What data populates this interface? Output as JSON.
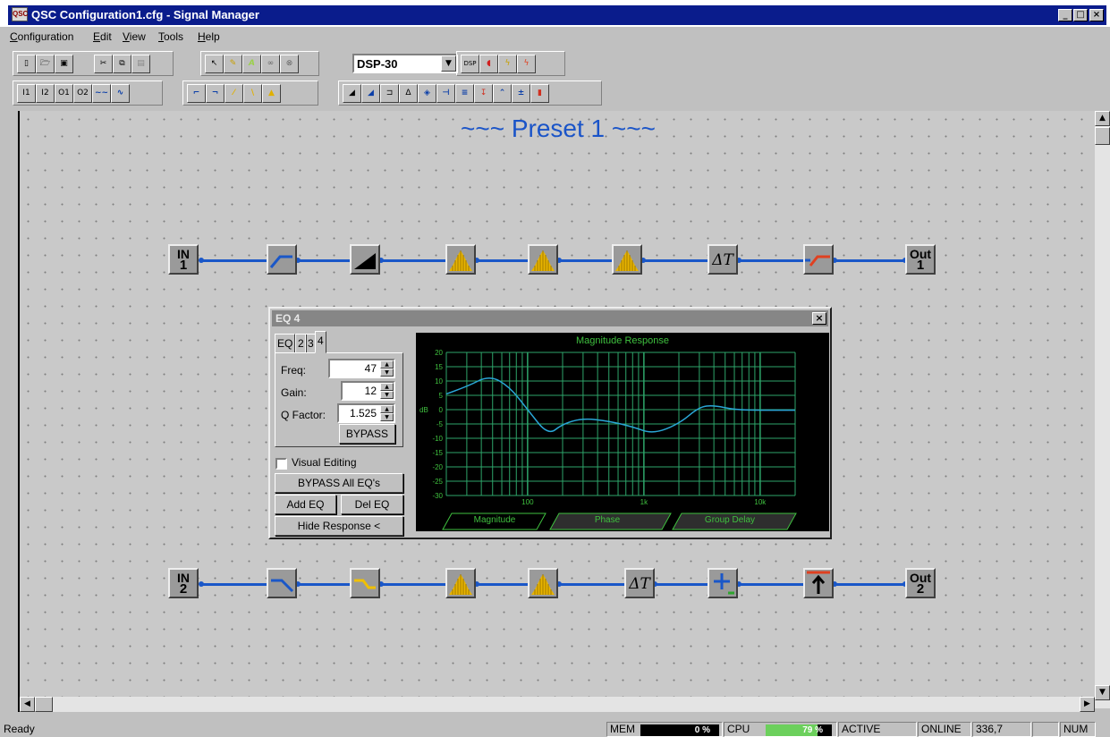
{
  "window": {
    "title": "QSC Configuration1.cfg - Signal Manager",
    "app_icon_text": "QSC",
    "buttons": {
      "minimize": "_",
      "maximize": "□",
      "close": "×"
    }
  },
  "menu": [
    {
      "label": "Configuration",
      "accel": "C",
      "rest": "onfiguration"
    },
    {
      "label": "Edit",
      "accel": "E",
      "rest": "dit"
    },
    {
      "label": "View",
      "accel": "V",
      "rest": "iew"
    },
    {
      "label": "Tools",
      "accel": "T",
      "rest": "ools"
    },
    {
      "label": "Help",
      "accel": "H",
      "rest": "elp"
    }
  ],
  "toolbar": {
    "file_buttons": [
      "new-icon",
      "open-icon",
      "save-icon",
      "cut-icon",
      "copy-icon",
      "paste-icon"
    ],
    "tool_buttons": [
      "pointer-icon",
      "pencil-icon",
      "text-icon",
      "link-icon",
      "disconnect-icon"
    ],
    "device_select": "DSP-30",
    "device_buttons": [
      "dsp-upload-icon",
      "speaker-icon",
      "connect-icon",
      "disconnect-plug-icon"
    ],
    "io_buttons": [
      {
        "icon": "input-1-icon",
        "text": "I1"
      },
      {
        "icon": "input-2-icon",
        "text": "I2"
      },
      {
        "icon": "output-1-icon",
        "text": "O1"
      },
      {
        "icon": "output-2-icon",
        "text": "O2"
      },
      {
        "icon": "noise-icon",
        "text": "~~"
      },
      {
        "icon": "sine-icon",
        "text": "∿"
      }
    ],
    "filter_buttons": [
      {
        "icon": "highpass-icon",
        "text": "⌐"
      },
      {
        "icon": "lowpass-icon",
        "text": "¬"
      },
      {
        "icon": "high-shelf-icon",
        "text": "⁄"
      },
      {
        "icon": "low-shelf-icon",
        "text": "\\"
      },
      {
        "icon": "parametric-eq-icon",
        "text": "▲"
      }
    ],
    "processing_buttons": [
      {
        "icon": "gain-icon",
        "text": "◢"
      },
      {
        "icon": "compressor-icon",
        "text": "◢"
      },
      {
        "icon": "gate-icon",
        "text": "⊐"
      },
      {
        "icon": "delay-icon",
        "text": "Δ"
      },
      {
        "icon": "router-icon",
        "text": "◈"
      },
      {
        "icon": "splitter-icon",
        "text": "⊣"
      },
      {
        "icon": "mixer-icon",
        "text": "≡"
      },
      {
        "icon": "limiter-icon",
        "text": "↧"
      },
      {
        "icon": "expander-icon",
        "text": "⌃"
      },
      {
        "icon": "polarity-icon",
        "text": "±"
      },
      {
        "icon": "meter-icon",
        "text": "▮"
      }
    ]
  },
  "canvas": {
    "title": "~~~ Preset 1 ~~~",
    "chain1": {
      "in_label": [
        "IN",
        "1"
      ],
      "out_label": [
        "Out",
        "1"
      ],
      "blocks": [
        "highpass-block",
        "gain-block",
        "eq-block-1",
        "eq-block-2",
        "eq-block-3",
        "delay-block",
        "crossover-block"
      ]
    },
    "chain2": {
      "in_label": [
        "IN",
        "2"
      ],
      "out_label": [
        "Out",
        "2"
      ],
      "blocks": [
        "lowpass-block",
        "low-shelf-block",
        "eq-block-1",
        "eq-block-2",
        "delay-block",
        "mixer-block",
        "limiter-block"
      ]
    },
    "delta_symbol": "ΔT"
  },
  "eq_dialog": {
    "title": "EQ 4",
    "close": "×",
    "tabs": [
      "EQ",
      "2",
      "3",
      "4"
    ],
    "active_tab": "4",
    "freq_label": "Freq:",
    "freq_value": "47",
    "gain_label": "Gain:",
    "gain_value": "12",
    "q_label": "Q Factor:",
    "q_value": "1.525",
    "bypass_label": "BYPASS",
    "visual_editing_label": "Visual Editing",
    "visual_editing_checked": false,
    "bypass_all_label": "BYPASS All EQ's",
    "add_eq_label": "Add EQ",
    "del_eq_label": "Del EQ",
    "hide_response_label": "Hide Response <",
    "response": {
      "title": "Magnitude Response",
      "ylabel": "dB",
      "y_ticks": [
        "20",
        "15",
        "10",
        "5",
        "0",
        "-5",
        "-10",
        "-15",
        "-20",
        "-25",
        "-30"
      ],
      "x_ticks": [
        "100",
        "1k",
        "10k"
      ],
      "tabs": [
        "Magnitude",
        "Phase",
        "Group Delay"
      ],
      "curve_color": "#2aa6d6",
      "grid_color": "#2ea56a",
      "curve": [
        [
          20,
          5.5
        ],
        [
          30,
          8
        ],
        [
          47,
          12
        ],
        [
          70,
          8
        ],
        [
          100,
          0
        ],
        [
          150,
          -9
        ],
        [
          200,
          -5
        ],
        [
          300,
          -3
        ],
        [
          500,
          -4
        ],
        [
          800,
          -6
        ],
        [
          1200,
          -8.5
        ],
        [
          2000,
          -5
        ],
        [
          3000,
          1
        ],
        [
          4000,
          1.5
        ],
        [
          6000,
          0
        ],
        [
          10000,
          -0.2
        ],
        [
          20000,
          -0.2
        ]
      ]
    }
  },
  "status": {
    "ready": "Ready",
    "mem_label": "MEM",
    "mem_value": "0 %",
    "mem_fraction": 0,
    "cpu_label": "CPU",
    "cpu_value": "79 %",
    "cpu_fraction": 0.79,
    "active": "ACTIVE",
    "online": "ONLINE",
    "coords": "336,7",
    "num": "NUM"
  }
}
